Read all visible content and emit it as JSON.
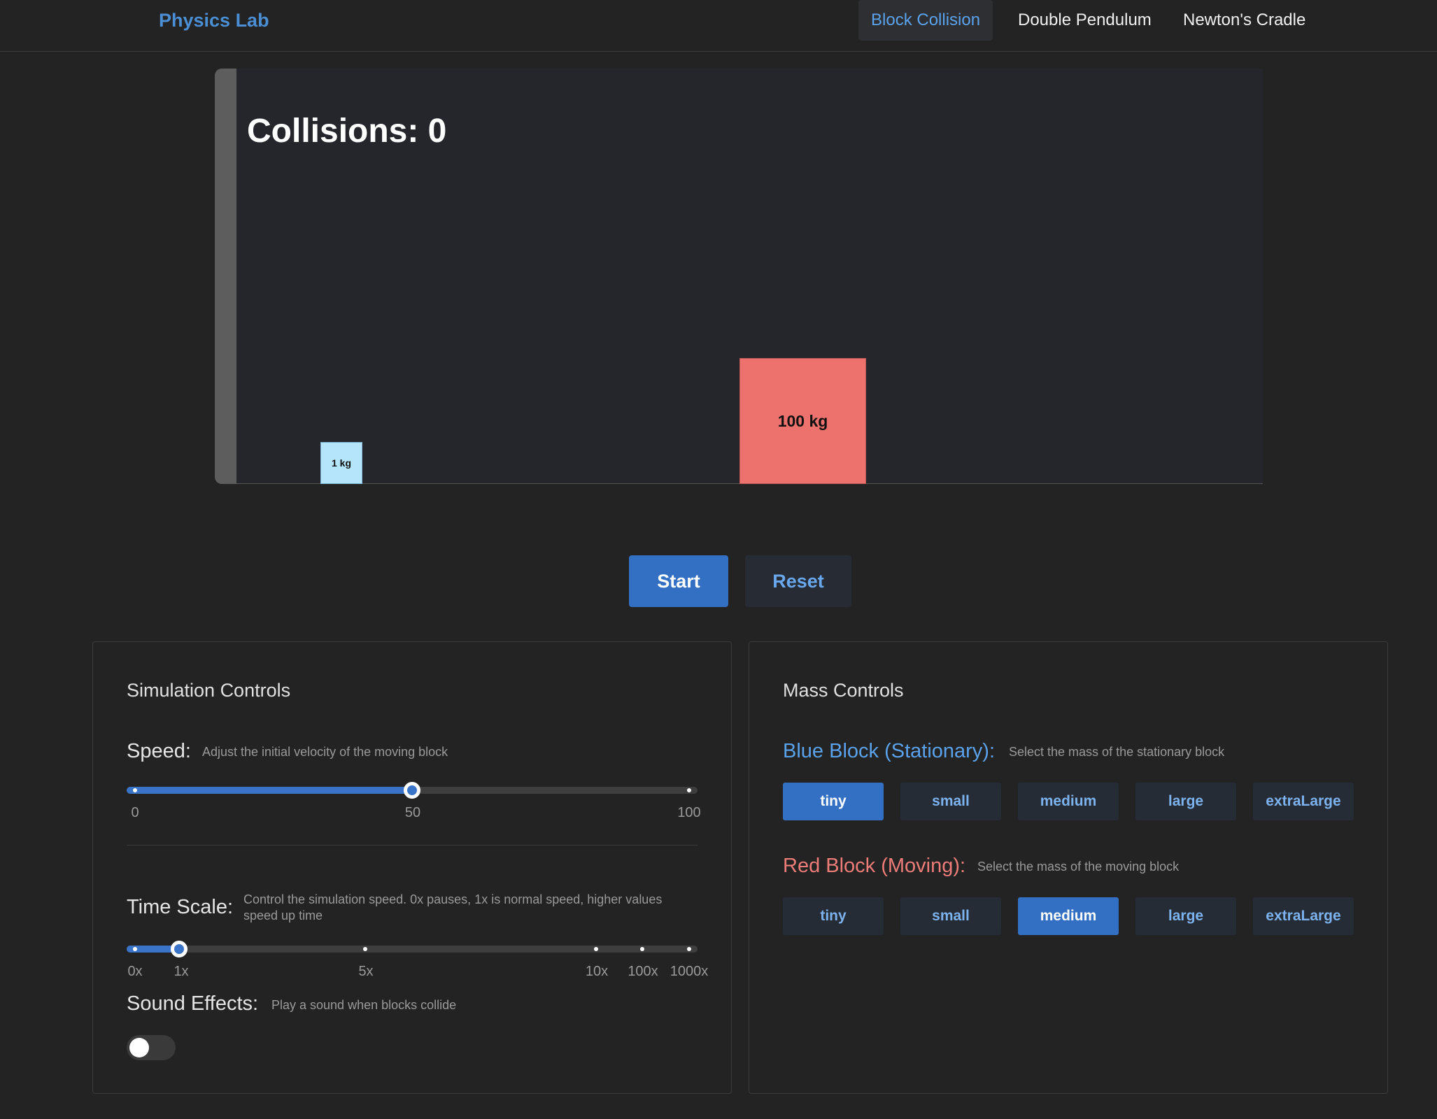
{
  "header": {
    "brand": "Physics Lab",
    "nav": [
      {
        "label": "Block Collision",
        "active": true
      },
      {
        "label": "Double Pendulum",
        "active": false
      },
      {
        "label": "Newton's Cradle",
        "active": false
      }
    ]
  },
  "simulation": {
    "collisions_label": "Collisions: 0",
    "blue_block_label": "1 kg",
    "red_block_label": "100 kg",
    "blue_color": "#b5e5fb",
    "red_color": "#ed716c"
  },
  "buttons": {
    "start": "Start",
    "reset": "Reset"
  },
  "simulation_controls": {
    "title": "Simulation Controls",
    "speed": {
      "label": "Speed:",
      "desc": "Adjust the initial velocity of the moving block",
      "ticks": [
        "0",
        "50",
        "100"
      ],
      "min": 0,
      "max": 100,
      "value": 50
    },
    "time_scale": {
      "label": "Time Scale:",
      "desc": "Control the simulation speed. 0x pauses, 1x is normal speed, higher values speed up time",
      "ticks": [
        "0x",
        "1x",
        "5x",
        "10x",
        "100x",
        "1000x"
      ],
      "selected": "1x"
    },
    "sound": {
      "label": "Sound Effects:",
      "desc": "Play a sound when blocks collide",
      "enabled": false
    }
  },
  "mass_controls": {
    "title": "Mass Controls",
    "blue": {
      "label": "Blue Block (Stationary):",
      "desc": "Select the mass of the stationary block",
      "options": [
        "tiny",
        "small",
        "medium",
        "large",
        "extraLarge"
      ],
      "selected": "tiny"
    },
    "red": {
      "label": "Red Block (Moving):",
      "desc": "Select the mass of the moving block",
      "options": [
        "tiny",
        "small",
        "medium",
        "large",
        "extraLarge"
      ],
      "selected": "medium"
    }
  },
  "accent_color": "#3370c4"
}
